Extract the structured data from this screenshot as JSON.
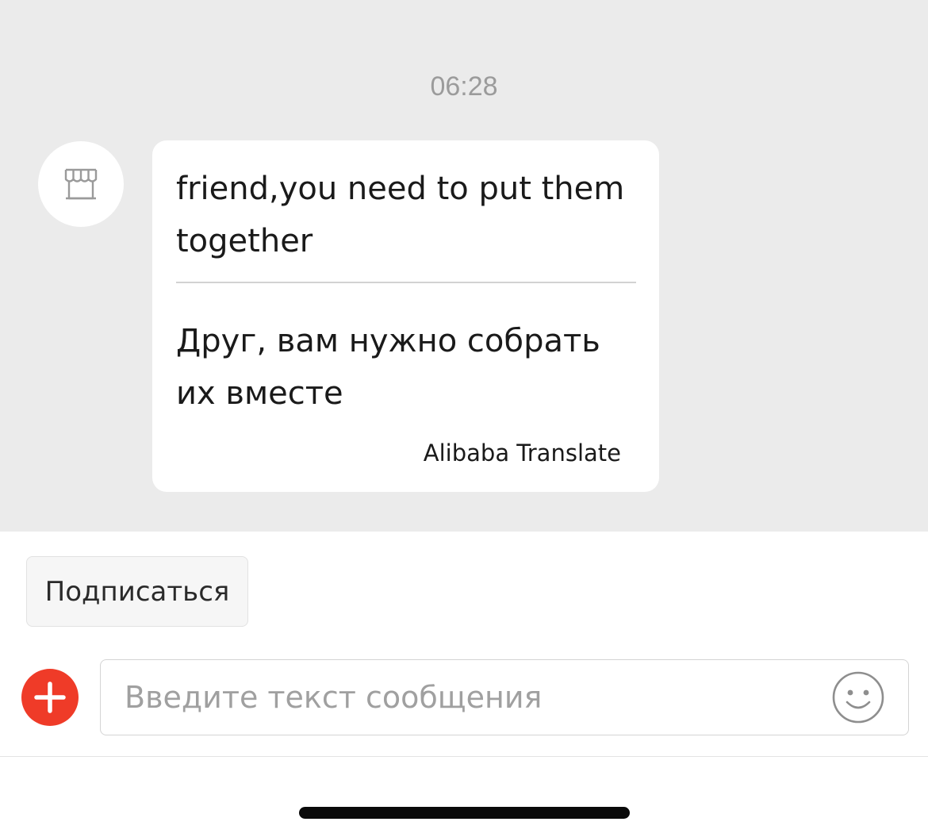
{
  "chat": {
    "timestamp": "06:28",
    "message": {
      "original_text": "friend,you need to put them together",
      "translated_text": "Друг, вам нужно собрать их вместе",
      "translation_credit": "Alibaba Translate"
    }
  },
  "actions": {
    "subscribe_label": "Подписаться"
  },
  "composer": {
    "placeholder": "Введите текст сообщения"
  },
  "icons": {
    "avatar": "store-icon",
    "add": "plus-icon",
    "emoji": "smiley-icon"
  },
  "colors": {
    "chat_background": "#ebebeb",
    "accent": "#ef3b28"
  }
}
